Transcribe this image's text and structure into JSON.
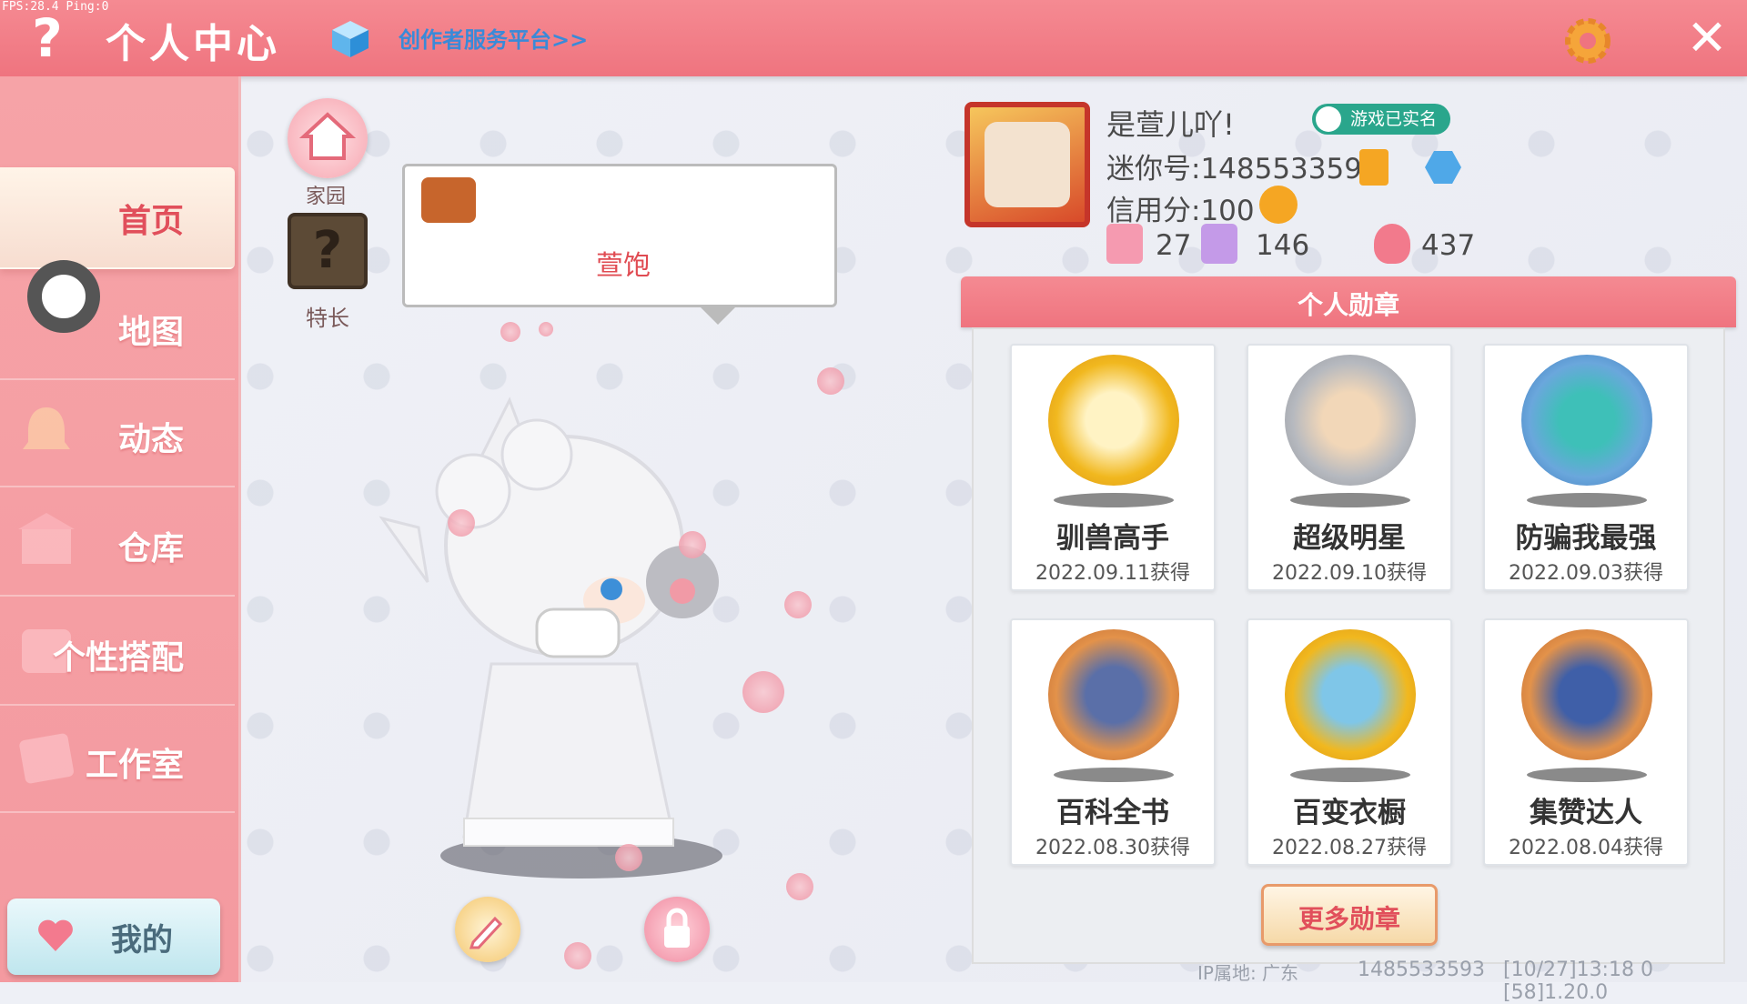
{
  "debug": {
    "fps": "FPS:28.4  Ping:0"
  },
  "topbar": {
    "help_icon": "question-mark-icon",
    "title": "个人中心",
    "creator_link": "创作者服务平台>>",
    "settings_icon": "gear-icon",
    "close_icon": "close-icon",
    "accent": "#ef747f"
  },
  "sidebar": {
    "items": [
      {
        "label": "首页",
        "icon": "home-icon",
        "active": true
      },
      {
        "label": "地图",
        "icon": "map-icon",
        "active": false
      },
      {
        "label": "动态",
        "icon": "bell-icon",
        "active": false
      },
      {
        "label": "仓库",
        "icon": "warehouse-icon",
        "active": false
      },
      {
        "label": "个性搭配",
        "icon": "outfit-icon",
        "active": false
      },
      {
        "label": "工作室",
        "icon": "studio-icon",
        "active": false
      }
    ],
    "mine_label": "我的"
  },
  "middle": {
    "home_label": "家园",
    "skill_label": "特长",
    "bubble_text": "萱饱",
    "skill_symbol": "?"
  },
  "profile": {
    "nickname": "是萱儿吖!",
    "realname_badge": "游戏已实名",
    "mini_no": "迷你号:1485533593",
    "credit": "信用分:100",
    "stats": [
      {
        "icon": "bookmark-plus-icon",
        "value": "27"
      },
      {
        "icon": "trophy-icon",
        "value": "146"
      },
      {
        "icon": "flame-icon",
        "value": "437"
      }
    ]
  },
  "medals": {
    "header": "个人勋章",
    "items": [
      {
        "name": "驯兽高手",
        "date": "2022.09.11获得",
        "color": "#f1b81f"
      },
      {
        "name": "超级明星",
        "date": "2022.09.10获得",
        "color": "#b6b9bf"
      },
      {
        "name": "防骗我最强",
        "date": "2022.09.03获得",
        "color": "#6aa7dc"
      },
      {
        "name": "百科全书",
        "date": "2022.08.30获得",
        "color": "#e3924a"
      },
      {
        "name": "百变衣橱",
        "date": "2022.08.27获得",
        "color": "#f1b81f"
      },
      {
        "name": "集赞达人",
        "date": "2022.08.04获得",
        "color": "#e3924a"
      }
    ],
    "more_label": "更多勋章"
  },
  "footer": {
    "ip": "IP属地: 广东",
    "uid": "1485533593",
    "version": "[10/27]13:18 0  [58]1.20.0"
  }
}
